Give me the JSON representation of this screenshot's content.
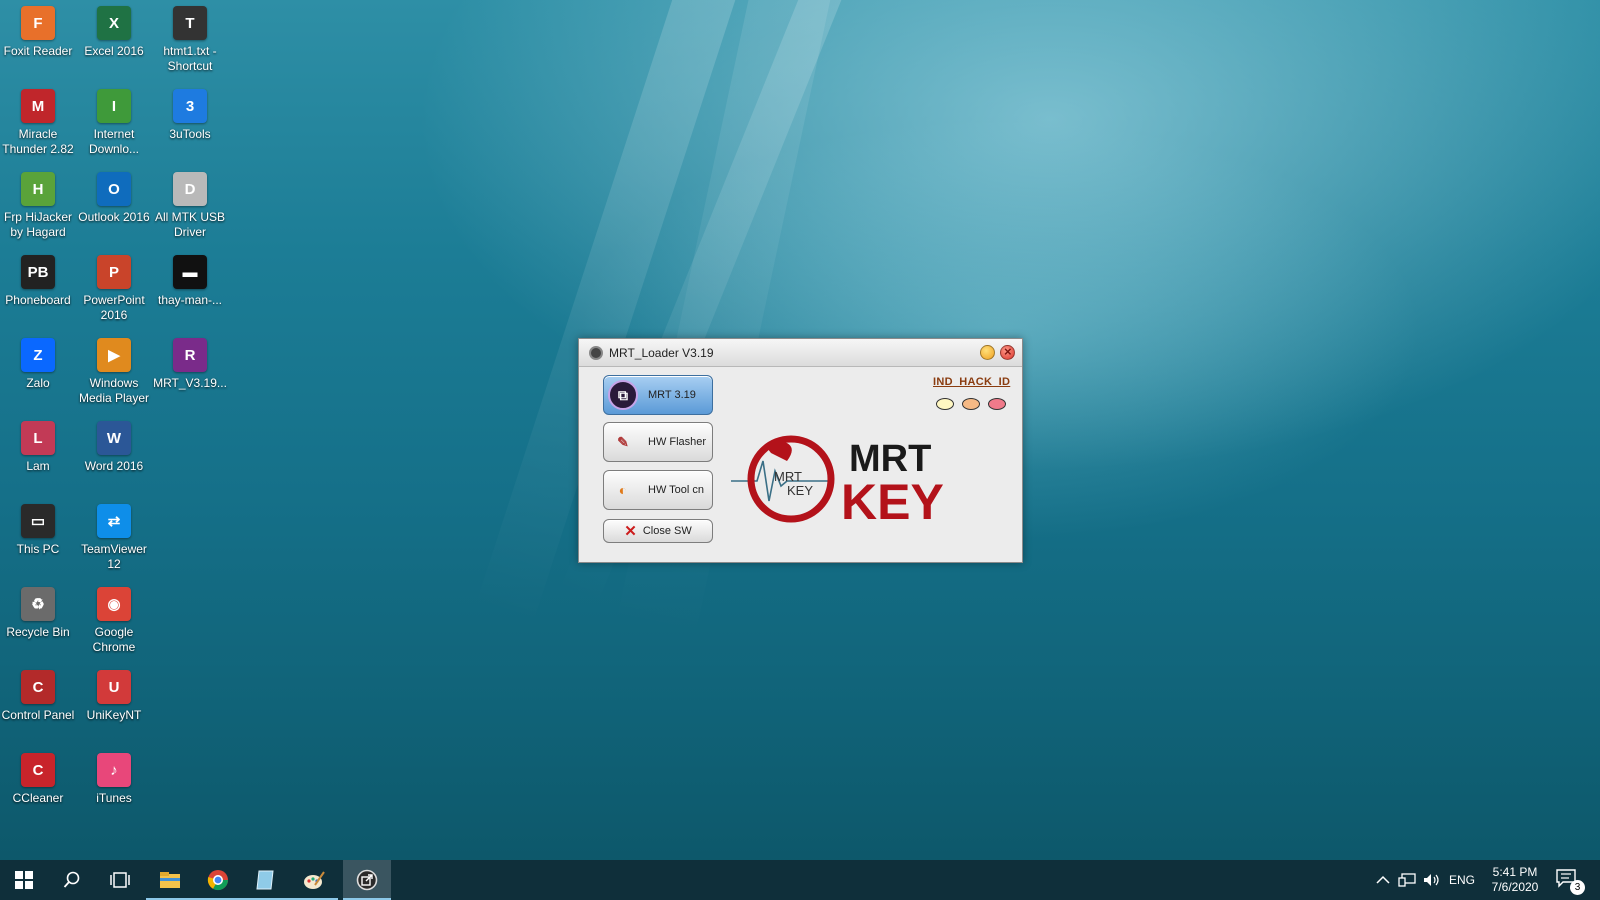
{
  "desktop": {
    "icons": [
      {
        "label": "Foxit Reader",
        "color": "#e8702a",
        "glyph": "F"
      },
      {
        "label": "Excel 2016",
        "color": "#1f7244",
        "glyph": "X"
      },
      {
        "label": "htmt1.txt -\nShortcut",
        "color": "#333333",
        "glyph": "T"
      },
      {
        "label": "Miracle\nThunder 2.82",
        "color": "#c0262b",
        "glyph": "M"
      },
      {
        "label": "Internet\nDownlo...",
        "color": "#3f9a3a",
        "glyph": "I"
      },
      {
        "label": "3uTools",
        "color": "#1e7be0",
        "glyph": "3"
      },
      {
        "label": "Frp HiJacker\nby Hagard",
        "color": "#5aa33a",
        "glyph": "H"
      },
      {
        "label": "Outlook 2016",
        "color": "#0f6cbd",
        "glyph": "O"
      },
      {
        "label": "All MTK USB\nDriver",
        "color": "#b9b9b9",
        "glyph": "D"
      },
      {
        "label": "Phoneboard",
        "color": "#222222",
        "glyph": "PB"
      },
      {
        "label": "PowerPoint\n2016",
        "color": "#c9442a",
        "glyph": "P"
      },
      {
        "label": "thay-man-...",
        "color": "#111111",
        "glyph": "▬"
      },
      {
        "label": "Zalo",
        "color": "#0a68ff",
        "glyph": "Z"
      },
      {
        "label": "Windows\nMedia Player",
        "color": "#e08a1e",
        "glyph": "▶"
      },
      {
        "label": "MRT_V3.19...",
        "color": "#7a2b8a",
        "glyph": "R"
      },
      {
        "label": "Lam",
        "color": "#c23a56",
        "glyph": "L"
      },
      {
        "label": "Word 2016",
        "color": "#2b5797",
        "glyph": "W"
      },
      {
        "label": "",
        "color": "#00000000",
        "glyph": ""
      },
      {
        "label": "This PC",
        "color": "#2a2a2a",
        "glyph": "▭"
      },
      {
        "label": "TeamViewer\n12",
        "color": "#0e8ee9",
        "glyph": "⇄"
      },
      {
        "label": "",
        "color": "#00000000",
        "glyph": ""
      },
      {
        "label": "Recycle Bin",
        "color": "#6b6b6b",
        "glyph": "♻"
      },
      {
        "label": "Google\nChrome",
        "color": "#db4437",
        "glyph": "◉"
      },
      {
        "label": "",
        "color": "#00000000",
        "glyph": ""
      },
      {
        "label": "Control Panel",
        "color": "#b32a2a",
        "glyph": "C"
      },
      {
        "label": "UniKeyNT",
        "color": "#d23a3a",
        "glyph": "U"
      },
      {
        "label": "",
        "color": "#00000000",
        "glyph": ""
      },
      {
        "label": "CCleaner",
        "color": "#c8242b",
        "glyph": "C"
      },
      {
        "label": "iTunes",
        "color": "#e8477a",
        "glyph": "♪"
      }
    ]
  },
  "dialog": {
    "title": "MRT_Loader V3.19",
    "buttons": {
      "mrt": "MRT 3.19",
      "hw_flasher": "HW Flasher",
      "hw_tool": "HW Tool cn",
      "close_sw": "Close SW"
    },
    "hack_link": "IND_HACK_ID",
    "dots": [
      "#fff7c2",
      "#f5b985",
      "#f07a8a"
    ],
    "logo": {
      "small_mrt": "MRT",
      "small_key": "KEY",
      "big_mrt": "MRT",
      "big_key": "KEY",
      "accent": "#b3121a"
    }
  },
  "taskbar": {
    "apps": [
      "start-icon",
      "search-icon",
      "task-view-icon",
      "file-explorer-icon",
      "chrome-icon",
      "notepad-icon",
      "paint-icon",
      "mrt-loader-icon"
    ],
    "tray": {
      "language": "ENG",
      "time": "5:41 PM",
      "date": "7/6/2020",
      "notifications": "3"
    }
  }
}
